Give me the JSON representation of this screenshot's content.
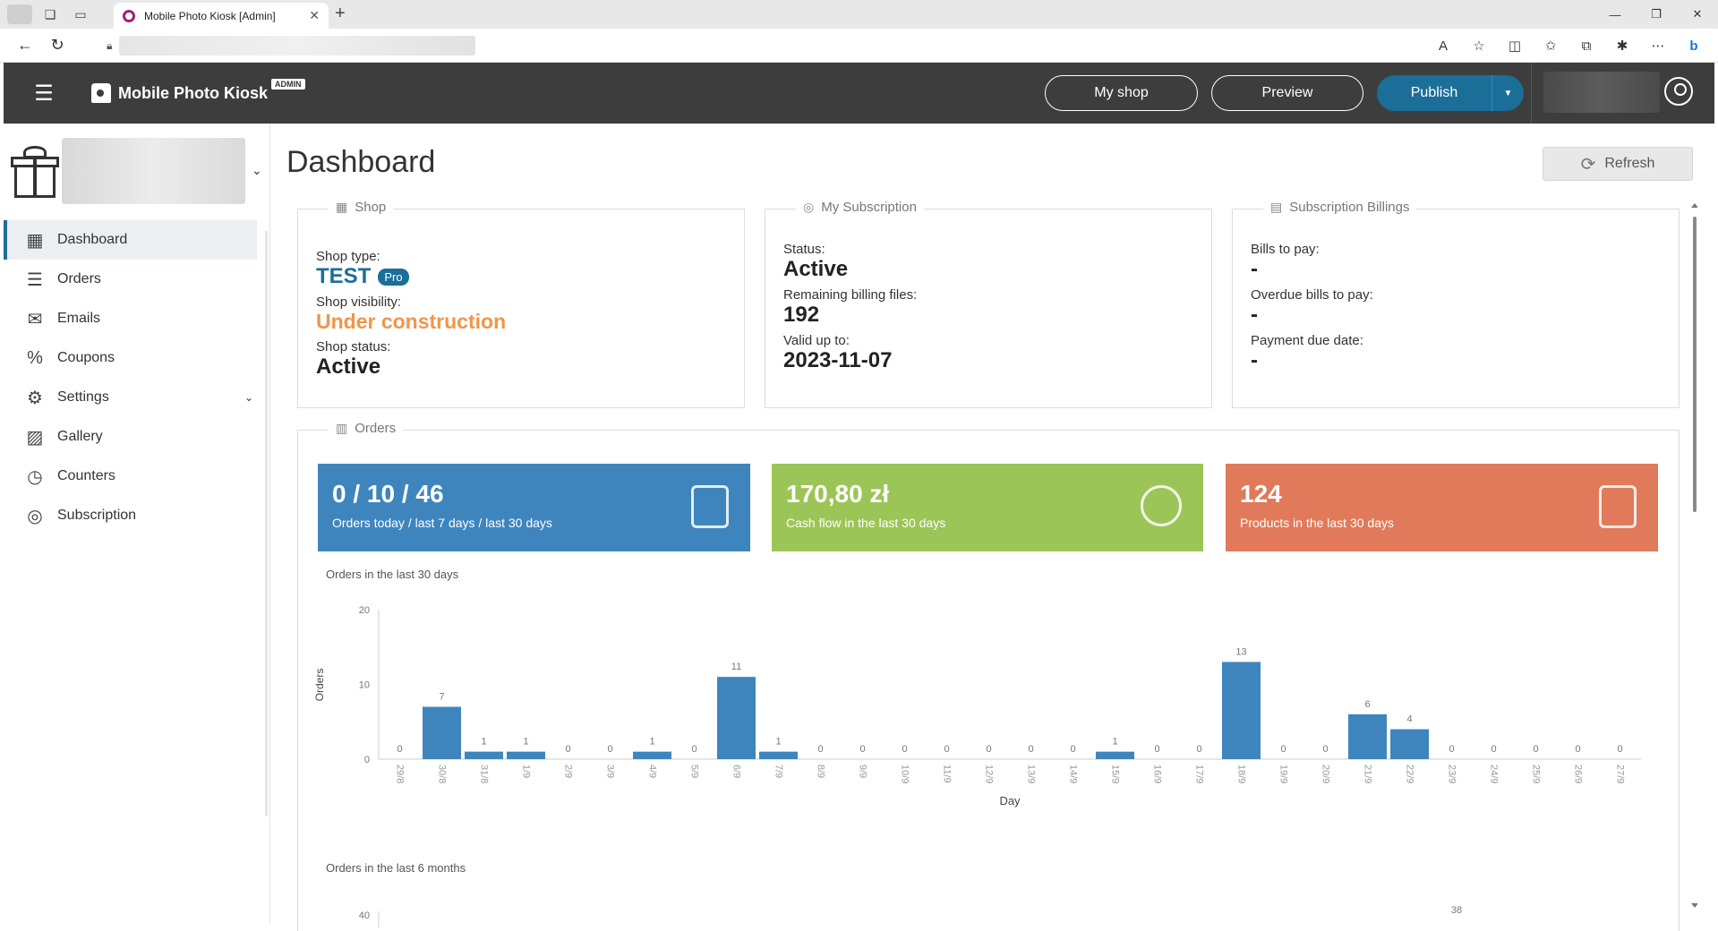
{
  "browser": {
    "tab_title": "Mobile Photo Kiosk [Admin]",
    "tab_close": "✕",
    "new_tab": "+",
    "win_min": "—",
    "win_max": "❐",
    "win_close": "✕"
  },
  "header": {
    "brand": "Mobile Photo Kiosk",
    "admin_badge": "ADMIN",
    "my_shop": "My shop",
    "preview": "Preview",
    "publish": "Publish"
  },
  "sidebar": {
    "items": [
      {
        "label": "Dashboard",
        "icon": "dashboard-icon",
        "glyph": "▦"
      },
      {
        "label": "Orders",
        "icon": "orders-icon",
        "glyph": "☰"
      },
      {
        "label": "Emails",
        "icon": "email-icon",
        "glyph": "✉"
      },
      {
        "label": "Coupons",
        "icon": "coupon-icon",
        "glyph": "%"
      },
      {
        "label": "Settings",
        "icon": "gear-icon",
        "glyph": "⚙"
      },
      {
        "label": "Gallery",
        "icon": "gallery-icon",
        "glyph": "▨"
      },
      {
        "label": "Counters",
        "icon": "stopwatch-icon",
        "glyph": "◷"
      },
      {
        "label": "Subscription",
        "icon": "subscription-icon",
        "glyph": "◎"
      }
    ]
  },
  "main": {
    "title": "Dashboard",
    "refresh": "Refresh",
    "shop": {
      "legend": "Shop",
      "type_label": "Shop type:",
      "type_value": "TEST",
      "type_badge": "Pro",
      "visibility_label": "Shop visibility:",
      "visibility_value": "Under construction",
      "status_label": "Shop status:",
      "status_value": "Active"
    },
    "subscription": {
      "legend": "My Subscription",
      "status_label": "Status:",
      "status_value": "Active",
      "remaining_label": "Remaining billing files:",
      "remaining_value": "192",
      "valid_label": "Valid up to:",
      "valid_value": "2023-11-07"
    },
    "billings": {
      "legend": "Subscription Billings",
      "bills_label": "Bills to pay:",
      "bills_value": "-",
      "overdue_label": "Overdue bills to pay:",
      "overdue_value": "-",
      "due_label": "Payment due date:",
      "due_value": "-"
    },
    "orders": {
      "legend": "Orders",
      "kpi1_big": "0 / 10 / 46",
      "kpi1_small": "Orders today / last 7 days / last 30 days",
      "kpi2_big": "170,80 zł",
      "kpi2_small": "Cash flow in the last 30 days",
      "kpi3_big": "124",
      "kpi3_small": "Products in the last 30 days",
      "chart1_title": "Orders in the last 30 days",
      "chart2_title": "Orders in the last 6 months"
    },
    "colors": {
      "kpi_blue": "#3f85bd",
      "kpi_green": "#9cc557",
      "kpi_red": "#e07a5a",
      "bar": "#3f85bd"
    }
  },
  "chart_data": [
    {
      "type": "bar",
      "title": "Orders in the last 30 days",
      "xlabel": "Day",
      "ylabel": "Orders",
      "ylim": [
        0,
        20
      ],
      "yticks": [
        0,
        10,
        20
      ],
      "categories": [
        "29/8",
        "30/8",
        "31/8",
        "1/9",
        "2/9",
        "3/9",
        "4/9",
        "5/9",
        "6/9",
        "7/9",
        "8/9",
        "9/9",
        "10/9",
        "11/9",
        "12/9",
        "13/9",
        "14/9",
        "15/9",
        "16/9",
        "17/9",
        "18/9",
        "19/9",
        "20/9",
        "21/9",
        "22/9",
        "23/9",
        "24/9",
        "25/9",
        "26/9",
        "27/9"
      ],
      "values": [
        0,
        7,
        1,
        1,
        0,
        0,
        1,
        0,
        11,
        1,
        0,
        0,
        0,
        0,
        0,
        0,
        0,
        1,
        0,
        0,
        13,
        0,
        0,
        6,
        4,
        0,
        0,
        0,
        0,
        0
      ]
    },
    {
      "type": "bar",
      "title": "Orders in the last 6 months",
      "ylim": [
        0,
        40
      ],
      "yticks": [
        40
      ],
      "visible_labels": [
        "38"
      ]
    }
  ]
}
